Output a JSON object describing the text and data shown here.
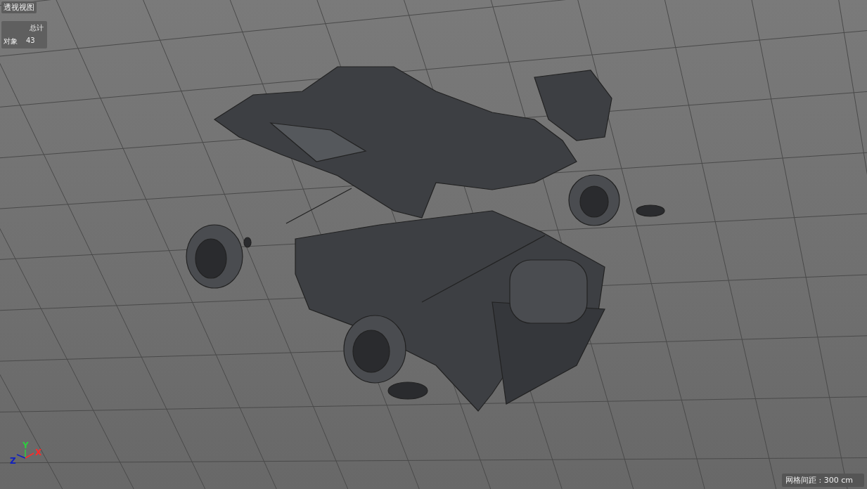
{
  "viewport": {
    "title": "透视视图"
  },
  "stats": {
    "header": "总计",
    "rows": [
      {
        "label": "对象",
        "value": "43"
      }
    ]
  },
  "axes": [
    {
      "label": "Y",
      "color": "#2ecc40"
    },
    {
      "label": "Z",
      "color": "#1020c0"
    },
    {
      "label": "X",
      "color": "#ff2a2a"
    }
  ],
  "grid_spacing": "网格间距 : 300 cm"
}
